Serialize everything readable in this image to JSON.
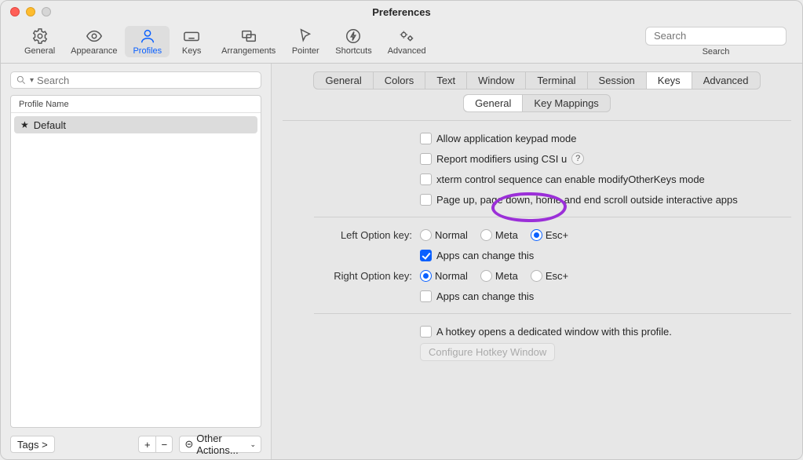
{
  "window": {
    "title": "Preferences"
  },
  "toolbar": {
    "items": [
      {
        "label": "General"
      },
      {
        "label": "Appearance"
      },
      {
        "label": "Profiles"
      },
      {
        "label": "Keys"
      },
      {
        "label": "Arrangements"
      },
      {
        "label": "Pointer"
      },
      {
        "label": "Shortcuts"
      },
      {
        "label": "Advanced"
      }
    ],
    "search_placeholder": "Search",
    "search_label": "Search"
  },
  "sidebar": {
    "search_placeholder": "Search",
    "header": "Profile Name",
    "profiles": [
      {
        "name": "Default",
        "starred": true
      }
    ],
    "tags_label": "Tags >",
    "other_actions_label": "Other Actions..."
  },
  "prefs_tabs": [
    "General",
    "Colors",
    "Text",
    "Window",
    "Terminal",
    "Session",
    "Keys",
    "Advanced"
  ],
  "prefs_tabs_active": "Keys",
  "keys_subtabs": [
    "General",
    "Key Mappings"
  ],
  "keys_subtabs_active": "General",
  "checks": {
    "allow_keypad": "Allow application keypad mode",
    "report_modifiers": "Report modifiers using CSI u",
    "xterm_control": "xterm control sequence can enable modifyOtherKeys mode",
    "page_scroll": "Page up, page down, home and end scroll outside interactive apps"
  },
  "option_keys": {
    "left_label": "Left Option key:",
    "right_label": "Right Option key:",
    "options": [
      "Normal",
      "Meta",
      "Esc+"
    ],
    "left_selected": "Esc+",
    "right_selected": "Normal",
    "apps_change": "Apps can change this",
    "left_apps_change_checked": true,
    "right_apps_change_checked": false
  },
  "hotkey": {
    "label": "A hotkey opens a dedicated window with this profile.",
    "button": "Configure Hotkey Window"
  }
}
